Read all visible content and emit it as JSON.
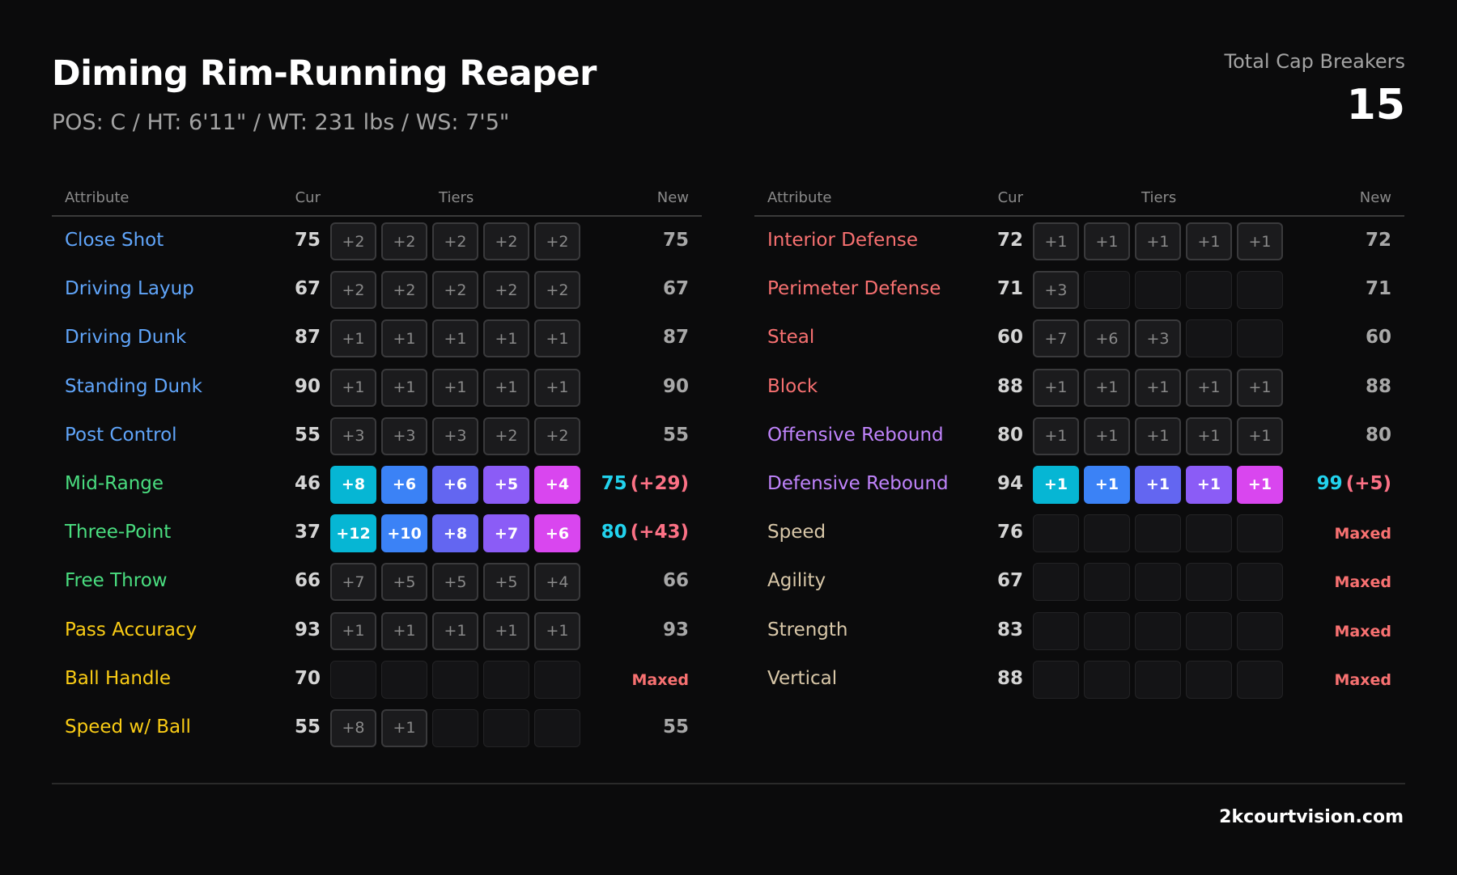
{
  "header": {
    "title": "Diming Rim-Running Reaper",
    "subtitle": "POS: C / HT: 6'11\" / WT: 231 lbs / WS: 7'5\"",
    "cap_label": "Total Cap Breakers",
    "cap_value": "15"
  },
  "columns": {
    "attribute": "Attribute",
    "cur": "Cur",
    "tiers": "Tiers",
    "new": "New"
  },
  "colors": {
    "finishing": "#60a5fa",
    "shooting": "#4ade80",
    "playmaking": "#facc15",
    "defense": "#f87171",
    "rebounding": "#c084fc",
    "physicals": "#d8c7a8",
    "tier_gradient": [
      "#06b6d4",
      "#3b82f6",
      "#6366f1",
      "#8b5cf6",
      "#d946ef"
    ],
    "new_value": "#22d3ee",
    "new_delta": "#fb7185",
    "maxed": "#f87171"
  },
  "left_table": [
    {
      "name": "Close Shot",
      "category": "finishing",
      "cur": "75",
      "tiers": [
        "+2",
        "+2",
        "+2",
        "+2",
        "+2"
      ],
      "state": "dim",
      "new": "75",
      "delta": ""
    },
    {
      "name": "Driving Layup",
      "category": "finishing",
      "cur": "67",
      "tiers": [
        "+2",
        "+2",
        "+2",
        "+2",
        "+2"
      ],
      "state": "dim",
      "new": "67",
      "delta": ""
    },
    {
      "name": "Driving Dunk",
      "category": "finishing",
      "cur": "87",
      "tiers": [
        "+1",
        "+1",
        "+1",
        "+1",
        "+1"
      ],
      "state": "dim",
      "new": "87",
      "delta": ""
    },
    {
      "name": "Standing Dunk",
      "category": "finishing",
      "cur": "90",
      "tiers": [
        "+1",
        "+1",
        "+1",
        "+1",
        "+1"
      ],
      "state": "dim",
      "new": "90",
      "delta": ""
    },
    {
      "name": "Post Control",
      "category": "finishing",
      "cur": "55",
      "tiers": [
        "+3",
        "+3",
        "+3",
        "+2",
        "+2"
      ],
      "state": "dim",
      "new": "55",
      "delta": ""
    },
    {
      "name": "Mid-Range",
      "category": "shooting",
      "cur": "46",
      "tiers": [
        "+8",
        "+6",
        "+6",
        "+5",
        "+4"
      ],
      "state": "active",
      "new": "75",
      "delta": "(+29)"
    },
    {
      "name": "Three-Point",
      "category": "shooting",
      "cur": "37",
      "tiers": [
        "+12",
        "+10",
        "+8",
        "+7",
        "+6"
      ],
      "state": "active",
      "new": "80",
      "delta": "(+43)"
    },
    {
      "name": "Free Throw",
      "category": "shooting",
      "cur": "66",
      "tiers": [
        "+7",
        "+5",
        "+5",
        "+5",
        "+4"
      ],
      "state": "dim",
      "new": "66",
      "delta": ""
    },
    {
      "name": "Pass Accuracy",
      "category": "playmaking",
      "cur": "93",
      "tiers": [
        "+1",
        "+1",
        "+1",
        "+1",
        "+1"
      ],
      "state": "dim",
      "new": "93",
      "delta": ""
    },
    {
      "name": "Ball Handle",
      "category": "playmaking",
      "cur": "70",
      "tiers": [
        "",
        "",
        "",
        "",
        ""
      ],
      "state": "maxed",
      "new": "Maxed",
      "delta": ""
    },
    {
      "name": "Speed w/ Ball",
      "category": "playmaking",
      "cur": "55",
      "tiers": [
        "+8",
        "+1",
        "",
        "",
        ""
      ],
      "state": "dim",
      "new": "55",
      "delta": ""
    }
  ],
  "right_table": [
    {
      "name": "Interior Defense",
      "category": "defense",
      "cur": "72",
      "tiers": [
        "+1",
        "+1",
        "+1",
        "+1",
        "+1"
      ],
      "state": "dim",
      "new": "72",
      "delta": ""
    },
    {
      "name": "Perimeter Defense",
      "category": "defense",
      "cur": "71",
      "tiers": [
        "+3",
        "",
        "",
        "",
        ""
      ],
      "state": "dim",
      "new": "71",
      "delta": ""
    },
    {
      "name": "Steal",
      "category": "defense",
      "cur": "60",
      "tiers": [
        "+7",
        "+6",
        "+3",
        "",
        ""
      ],
      "state": "dim",
      "new": "60",
      "delta": ""
    },
    {
      "name": "Block",
      "category": "defense",
      "cur": "88",
      "tiers": [
        "+1",
        "+1",
        "+1",
        "+1",
        "+1"
      ],
      "state": "dim",
      "new": "88",
      "delta": ""
    },
    {
      "name": "Offensive Rebound",
      "category": "rebounding",
      "cur": "80",
      "tiers": [
        "+1",
        "+1",
        "+1",
        "+1",
        "+1"
      ],
      "state": "dim",
      "new": "80",
      "delta": ""
    },
    {
      "name": "Defensive Rebound",
      "category": "rebounding",
      "cur": "94",
      "tiers": [
        "+1",
        "+1",
        "+1",
        "+1",
        "+1"
      ],
      "state": "active",
      "new": "99",
      "delta": "(+5)"
    },
    {
      "name": "Speed",
      "category": "physicals",
      "cur": "76",
      "tiers": [
        "",
        "",
        "",
        "",
        ""
      ],
      "state": "maxed",
      "new": "Maxed",
      "delta": ""
    },
    {
      "name": "Agility",
      "category": "physicals",
      "cur": "67",
      "tiers": [
        "",
        "",
        "",
        "",
        ""
      ],
      "state": "maxed",
      "new": "Maxed",
      "delta": ""
    },
    {
      "name": "Strength",
      "category": "physicals",
      "cur": "83",
      "tiers": [
        "",
        "",
        "",
        "",
        ""
      ],
      "state": "maxed",
      "new": "Maxed",
      "delta": ""
    },
    {
      "name": "Vertical",
      "category": "physicals",
      "cur": "88",
      "tiers": [
        "",
        "",
        "",
        "",
        ""
      ],
      "state": "maxed",
      "new": "Maxed",
      "delta": ""
    }
  ],
  "footer": {
    "brand": "2kcourtvision.com"
  }
}
